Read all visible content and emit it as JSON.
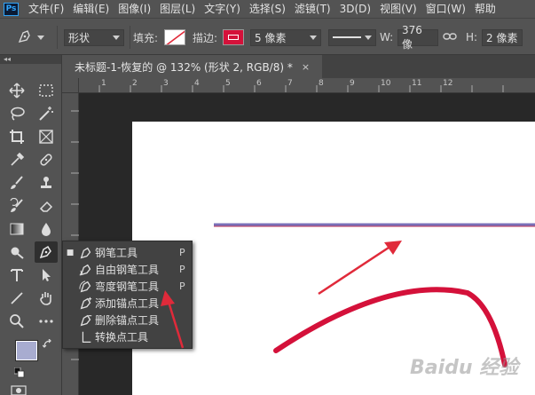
{
  "app": {
    "logo": "Ps",
    "menus": [
      "文件(F)",
      "编辑(E)",
      "图像(I)",
      "图层(L)",
      "文字(Y)",
      "选择(S)",
      "滤镜(T)",
      "3D(D)",
      "视图(V)",
      "窗口(W)",
      "帮助"
    ]
  },
  "options": {
    "tool_icon": "pen-icon",
    "mode_value": "形状",
    "fill_label": "填充:",
    "stroke_label": "描边:",
    "stroke_color": "#d4113a",
    "stroke_width": "5 像素",
    "w_label": "W:",
    "w_value": "376 像",
    "h_label": "H:",
    "h_value": "2 像素"
  },
  "toolbar": {
    "collapse": "◂◂"
  },
  "document": {
    "tab_title": "未标题-1-恢复的 @ 132% (形状 2, RGB/8) *",
    "close_glyph": "×",
    "ruler_labels": [
      "1",
      "2",
      "3",
      "4",
      "5",
      "6",
      "7",
      "8",
      "9",
      "10",
      "11",
      "12"
    ]
  },
  "flyout": {
    "items": [
      {
        "label": "钢笔工具",
        "key": "P",
        "selected": true,
        "icon": "pen-icon"
      },
      {
        "label": "自由钢笔工具",
        "key": "P",
        "selected": false,
        "icon": "freeform-pen-icon"
      },
      {
        "label": "弯度钢笔工具",
        "key": "P",
        "selected": false,
        "icon": "curvature-pen-icon"
      },
      {
        "label": "添加锚点工具",
        "key": "",
        "selected": false,
        "icon": "add-anchor-icon"
      },
      {
        "label": "删除锚点工具",
        "key": "",
        "selected": false,
        "icon": "delete-anchor-icon"
      },
      {
        "label": "转换点工具",
        "key": "",
        "selected": false,
        "icon": "convert-point-icon"
      }
    ]
  },
  "colors": {
    "foreground": "#a8acd0",
    "background": "#ffffff",
    "annotation_red": "#e02a3a",
    "curve_red": "#d4113a"
  },
  "watermark": "Baidu 经验"
}
